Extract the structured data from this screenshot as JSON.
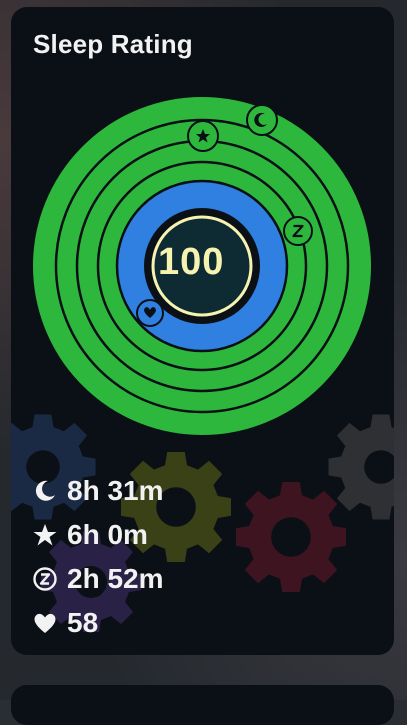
{
  "card": {
    "title": "Sleep Rating",
    "score": "100"
  },
  "colors": {
    "ring_green": "#2db83d",
    "ring_blue": "#2f80e0",
    "center_fill": "#0e2a33",
    "center_ring": "#f6f3b0",
    "text": "#f2f2f2"
  },
  "ring_icons": [
    {
      "name": "star-icon"
    },
    {
      "name": "moon-icon"
    },
    {
      "name": "z-icon"
    },
    {
      "name": "heart-icon"
    }
  ],
  "stats": [
    {
      "icon": "moon-icon",
      "value": "8h 31m"
    },
    {
      "icon": "star-icon",
      "value": "6h 0m"
    },
    {
      "icon": "z-circle-icon",
      "value": "2h 52m"
    },
    {
      "icon": "heart-icon",
      "value": "58"
    }
  ]
}
